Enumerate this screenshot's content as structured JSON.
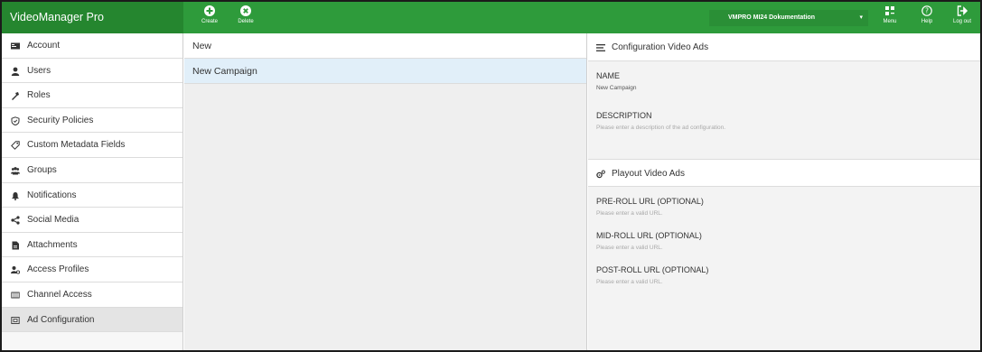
{
  "app": {
    "title": "VideoManager Pro"
  },
  "toolbar": {
    "create_label": "Create",
    "delete_label": "Delete"
  },
  "project_select": {
    "value": "VMPRO MI24 Dokumentation"
  },
  "header_actions": {
    "menu_label": "Menu",
    "help_label": "Help",
    "logout_label": "Log out"
  },
  "sidebar": {
    "items": [
      {
        "label": "Account",
        "icon": "account-icon"
      },
      {
        "label": "Users",
        "icon": "user-icon"
      },
      {
        "label": "Roles",
        "icon": "roles-icon"
      },
      {
        "label": "Security Policies",
        "icon": "shield-icon"
      },
      {
        "label": "Custom Metadata Fields",
        "icon": "tag-icon"
      },
      {
        "label": "Groups",
        "icon": "group-icon"
      },
      {
        "label": "Notifications",
        "icon": "bell-icon"
      },
      {
        "label": "Social Media",
        "icon": "share-icon"
      },
      {
        "label": "Attachments",
        "icon": "file-icon"
      },
      {
        "label": "Access Profiles",
        "icon": "access-profile-icon"
      },
      {
        "label": "Channel Access",
        "icon": "channel-icon"
      },
      {
        "label": "Ad Configuration",
        "icon": "ad-icon"
      }
    ],
    "active_index": 11
  },
  "middle": {
    "rows": [
      "New",
      "New Campaign"
    ]
  },
  "config": {
    "title": "Configuration Video Ads",
    "name_label": "NAME",
    "name_value": "New Campaign",
    "description_label": "DESCRIPTION",
    "description_placeholder": "Please enter a description of the ad configuration."
  },
  "playout": {
    "title": "Playout Video Ads",
    "preroll_label": "PRE-ROLL URL (OPTIONAL)",
    "preroll_placeholder": "Please enter a valid URL.",
    "midroll_label": "MID-ROLL URL (OPTIONAL)",
    "midroll_placeholder": "Please enter a valid URL.",
    "postroll_label": "POST-ROLL URL (OPTIONAL)",
    "postroll_placeholder": "Please enter a valid URL."
  },
  "colors": {
    "topbar": "#2e9b3b",
    "title_bg": "#25862f",
    "selected_row": "#e1eff9"
  }
}
